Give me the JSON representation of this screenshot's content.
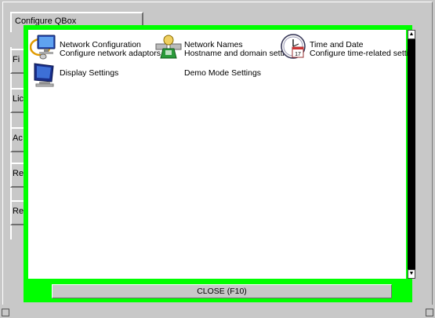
{
  "window": {
    "tab_title": "Configure QBox"
  },
  "side_tabs": [
    {
      "label": "Fi"
    },
    {
      "label": "Lic"
    },
    {
      "label": "Ac"
    },
    {
      "label": "Re"
    },
    {
      "label": "Re"
    }
  ],
  "items": [
    {
      "name": "Network Configuration",
      "description": "Configure network adaptors",
      "icon": "network-monitor-icon"
    },
    {
      "name": "Network Names",
      "description": "Hostname and domain settin",
      "icon": "network-names-icon"
    },
    {
      "name": "Time and Date",
      "description": "Configure time-related settin",
      "icon": "clock-calendar-icon"
    },
    {
      "name": "Display Settings",
      "description": "",
      "icon": "display-monitor-icon"
    },
    {
      "name": "Demo Mode Settings",
      "description": "",
      "icon": ""
    }
  ],
  "scrollbar": {
    "up_arrow": "▲",
    "down_arrow": "▼"
  },
  "footer": {
    "close_label": "CLOSE (F10)"
  },
  "colors": {
    "frame_green": "#00ff00",
    "panel_bg": "#ffffff",
    "chrome_gray": "#c8c8c8"
  }
}
